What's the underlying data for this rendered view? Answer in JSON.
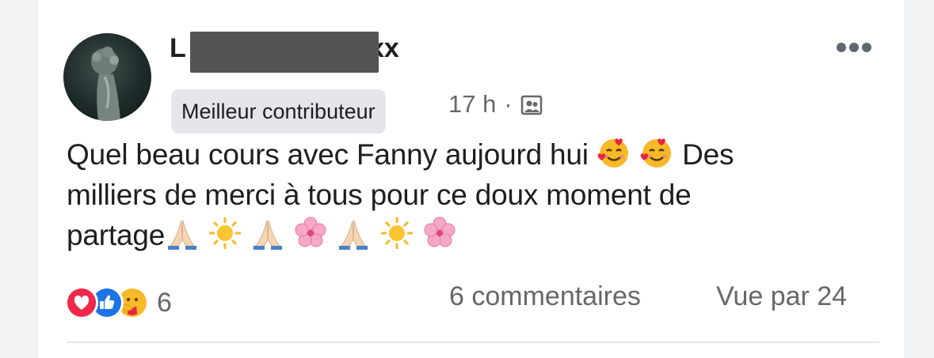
{
  "post": {
    "author": {
      "name_visible_start": "L",
      "name_visible_end": "xx",
      "avatar": "avatar-icon"
    },
    "badge": "Meilleur contributeur",
    "timestamp": "17 h",
    "separator": "·",
    "audience_icon": "group-icon",
    "text_line_1": "Quel beau cours avec Fanny aujourd hui",
    "text_line_1b": "Des",
    "text_line_2": "milliers de merci à tous pour ce doux moment de",
    "text_line_3": "partage",
    "reactions": {
      "icons": [
        "love-icon",
        "like-icon",
        "care-icon"
      ],
      "count": "6"
    },
    "comments": "6 commentaires",
    "views": "Vue par 24"
  },
  "colors": {
    "love": "#f0284a",
    "like": "#1b74e4",
    "care": "#f7b928",
    "secondary_text": "#65676b",
    "badge_bg": "#e4e6ea"
  }
}
